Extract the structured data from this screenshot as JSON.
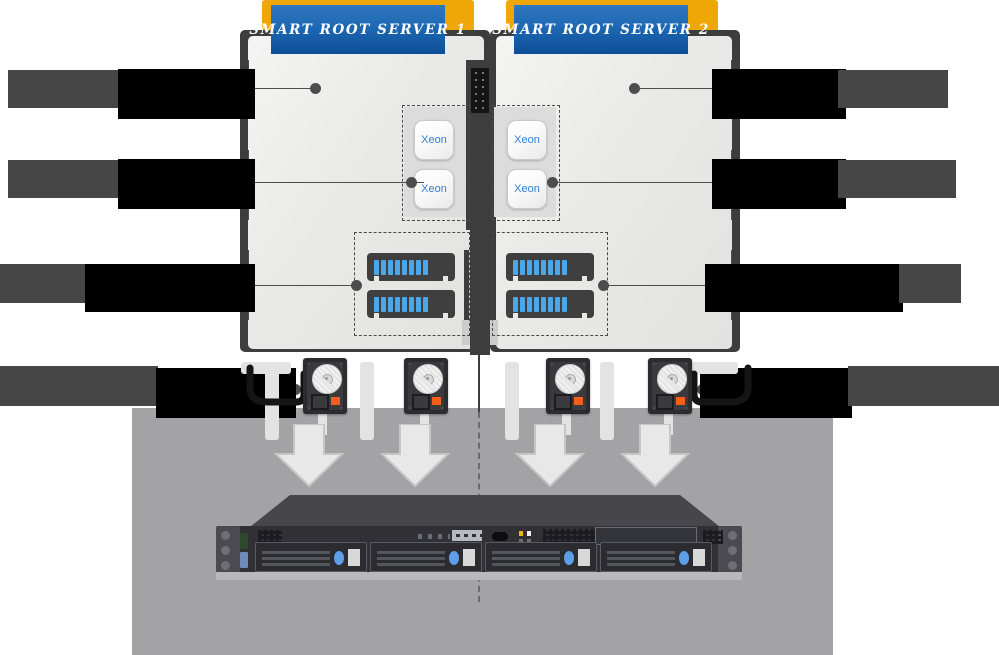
{
  "diagram": {
    "title": "Smart Root Server dual-node architecture diagram",
    "type": "hardware-architecture"
  },
  "servers": [
    {
      "id": "server-1",
      "plate_label": "SMART  ROOT  SERVER  1"
    },
    {
      "id": "server-2",
      "plate_label": "SMART  ROOT  SERVER  2"
    }
  ],
  "cpus": {
    "label": "Xeon",
    "items": [
      {
        "side": "left",
        "position": "upper",
        "label": "Xeon"
      },
      {
        "side": "left",
        "position": "lower",
        "label": "Xeon"
      },
      {
        "side": "right",
        "position": "upper",
        "label": "Xeon"
      },
      {
        "side": "right",
        "position": "lower",
        "label": "Xeon"
      }
    ]
  },
  "memory": {
    "modules": 4,
    "chips_per_module": 8,
    "chip_color": "#49a7ea"
  },
  "drives": {
    "count": 4,
    "connector_color": "#f4601a"
  },
  "rack": {
    "bays": 4,
    "units": "1U",
    "bay_led_color": "#5c9ee8"
  },
  "callouts": {
    "left": [
      {
        "row": 1,
        "redacted": true,
        "text": ""
      },
      {
        "row": 2,
        "redacted": true,
        "text": ""
      },
      {
        "row": 3,
        "redacted": true,
        "text": ""
      },
      {
        "row": 4,
        "redacted": true,
        "text": ""
      }
    ],
    "right": [
      {
        "row": 1,
        "redacted": true,
        "text": ""
      },
      {
        "row": 2,
        "redacted": true,
        "text": ""
      },
      {
        "row": 3,
        "redacted": true,
        "text": ""
      },
      {
        "row": 4,
        "redacted": true,
        "text": ""
      }
    ]
  },
  "colors": {
    "accent_orange": "#efa707",
    "plate_blue": "#1f69b5",
    "chassis_grey": "#3d3d3d",
    "body_grey": "#e9e9e7",
    "backdrop_grey": "#a3a3a5",
    "cpu_text_blue": "#2e7fd4",
    "redact_black": "#000000",
    "redact_grey": "#464646"
  }
}
